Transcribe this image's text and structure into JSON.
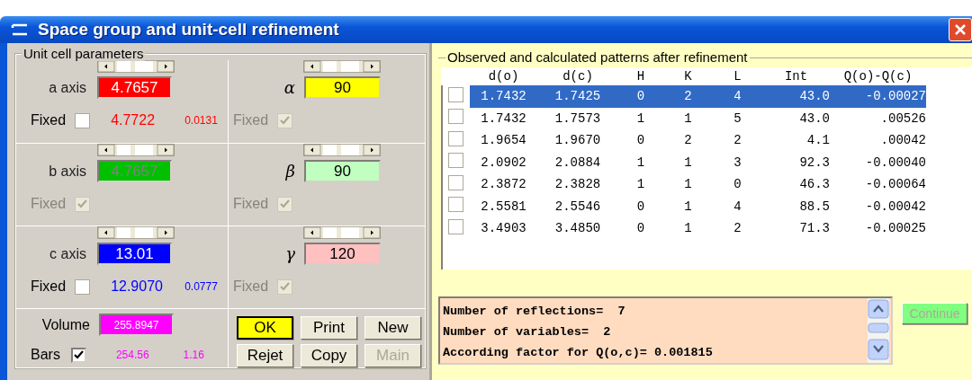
{
  "window": {
    "title": "Space group and unit-cell refinement"
  },
  "unit_cell": {
    "title": "Unit cell parameters",
    "axes": [
      {
        "label": "a axis",
        "value": "4.7657",
        "color": "#ff0000",
        "fixed_label": "Fixed",
        "fixed": false,
        "locked": false,
        "refined": "4.7722",
        "esd": "0.0131"
      },
      {
        "label": "b axis",
        "value": "4.7657",
        "color": "#00c000",
        "fixed_label": "Fixed",
        "fixed": true,
        "locked": true
      },
      {
        "label": "c axis",
        "value": "13.01",
        "color": "#0000ff",
        "fixed_label": "Fixed",
        "fixed": false,
        "locked": false,
        "refined": "12.9070",
        "esd": "0.0777"
      }
    ],
    "angles": [
      {
        "symbol": "α",
        "value": "90",
        "color": "#ffff00",
        "fixed_label": "Fixed",
        "fixed": true,
        "locked": true
      },
      {
        "symbol": "β",
        "value": "90",
        "color": "#c0ffc0",
        "fixed_label": "Fixed",
        "fixed": true,
        "locked": true
      },
      {
        "symbol": "γ",
        "value": "120",
        "color": "#ffc0c0",
        "fixed_label": "Fixed",
        "fixed": true,
        "locked": true
      }
    ],
    "volume": {
      "label": "Volume",
      "value": "255.8947",
      "color": "#ff00ff"
    },
    "bars": {
      "label": "Bars",
      "checked": true,
      "value": "254.56",
      "esd": "1.16"
    }
  },
  "buttons": [
    {
      "label": "OK",
      "highlighted": true,
      "disabled": false
    },
    {
      "label": "Print",
      "highlighted": false,
      "disabled": false
    },
    {
      "label": "New",
      "highlighted": false,
      "disabled": false
    },
    {
      "label": "Rejet",
      "highlighted": false,
      "disabled": false
    },
    {
      "label": "Copy",
      "highlighted": false,
      "disabled": false
    },
    {
      "label": "Main",
      "highlighted": false,
      "disabled": true
    }
  ],
  "patterns": {
    "title": "Observed and calculated patterns after refinement",
    "columns": [
      "d(o)",
      "d(c)",
      "H",
      "K",
      "L",
      "Int",
      "Q(o)-Q(c)"
    ],
    "rows": [
      {
        "checked": false,
        "selected": true,
        "cells": [
          "1.7432",
          "1.7425",
          "0",
          "2",
          "4",
          "43.0",
          "-0.00027"
        ]
      },
      {
        "checked": false,
        "selected": false,
        "cells": [
          "1.7432",
          "1.7573",
          "1",
          "1",
          "5",
          "43.0",
          ".00526"
        ]
      },
      {
        "checked": false,
        "selected": false,
        "cells": [
          "1.9654",
          "1.9670",
          "0",
          "2",
          "2",
          "4.1",
          ".00042"
        ]
      },
      {
        "checked": false,
        "selected": false,
        "cells": [
          "2.0902",
          "2.0884",
          "1",
          "1",
          "3",
          "92.3",
          "-0.00040"
        ]
      },
      {
        "checked": false,
        "selected": false,
        "cells": [
          "2.3872",
          "2.3828",
          "1",
          "1",
          "0",
          "46.3",
          "-0.00064"
        ]
      },
      {
        "checked": false,
        "selected": false,
        "cells": [
          "2.5581",
          "2.5546",
          "0",
          "1",
          "4",
          "88.5",
          "-0.00042"
        ]
      },
      {
        "checked": false,
        "selected": false,
        "cells": [
          "3.4903",
          "3.4850",
          "0",
          "1",
          "2",
          "71.3",
          "-0.00025"
        ]
      }
    ]
  },
  "log": {
    "lines": [
      "Number of reflections=  7",
      "Number of variables=  2",
      "According factor for Q(o,c)= 0.001815"
    ]
  },
  "continue_button": {
    "label": "Continue",
    "disabled": true
  }
}
